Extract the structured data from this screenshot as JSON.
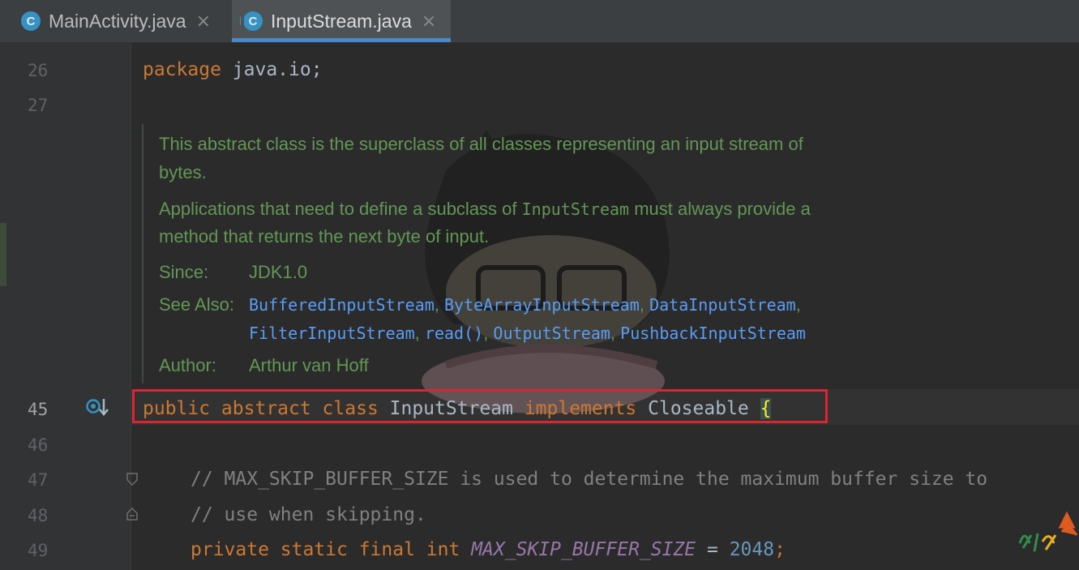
{
  "tabs": [
    {
      "label": "MainActivity.java",
      "icon": "class-c-icon",
      "active": false
    },
    {
      "label": "InputStream.java",
      "icon": "class-c-icon",
      "active": true
    }
  ],
  "line_numbers": {
    "l26": "26",
    "l27": "27",
    "l45": "45",
    "l46": "46",
    "l47": "47",
    "l48": "48",
    "l49": "49"
  },
  "code": {
    "line26_kw": "package",
    "line26_rest": " java.io;",
    "line45_kw": "public abstract class",
    "line45_name": " InputStream ",
    "line45_impl": "implements",
    "line45_iface": " Closeable ",
    "line45_brace": "{",
    "line47": "// MAX_SKIP_BUFFER_SIZE is used to determine the maximum buffer size to",
    "line48": "// use when skipping.",
    "line49_kw": "private static final int",
    "line49_const": "MAX_SKIP_BUFFER_SIZE",
    "line49_eq": " = ",
    "line49_num": "2048",
    "line49_end": ";"
  },
  "doc": {
    "p1_line1": "This abstract class is the superclass of all classes representing an input stream of",
    "p1_line2": "bytes.",
    "p2_a": "Applications that need to define a subclass of ",
    "p2_code": "InputStream",
    "p2_b": " must always provide a",
    "p2_line2": "method that returns the next byte of input.",
    "since_label": "Since:",
    "since_value": "JDK1.0",
    "see_label": "See Also:",
    "see_links": [
      "BufferedInputStream",
      "ByteArrayInputStream",
      "DataInputStream",
      "FilterInputStream",
      "read()",
      "OutputStream",
      "PushbackInputStream"
    ],
    "author_label": "Author:",
    "author_value": "Arthur van Hoff"
  },
  "colors": {
    "keyword": "#cc7832",
    "plain": "#a9b7c6",
    "comment": "#808080",
    "doc": "#629755",
    "doc_link": "#589df6",
    "constant": "#9876aa",
    "number": "#6897bb",
    "highlight_box": "#e0232f"
  }
}
